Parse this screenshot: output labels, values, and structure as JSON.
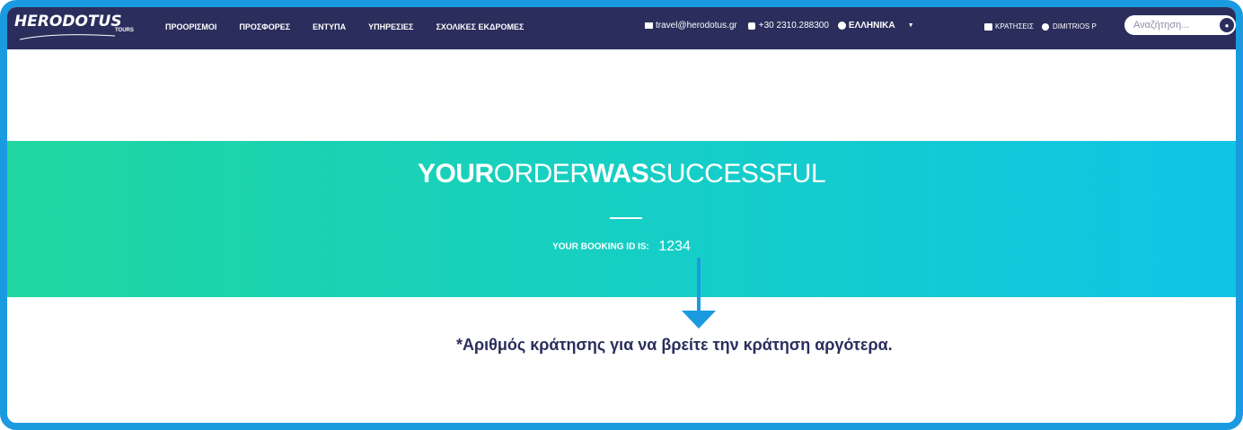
{
  "brand": {
    "logo_text": "HERODOTUS",
    "logo_sub": "TOURS"
  },
  "nav": {
    "items": [
      {
        "label": "ΠΡΟΟΡΙΣΜΟΙ"
      },
      {
        "label": "ΠΡΟΣΦΟΡΕΣ"
      },
      {
        "label": "ΕΝΤΥΠΑ"
      },
      {
        "label": "ΥΠΗΡΕΣΙΕΣ"
      },
      {
        "label": "ΣΧΟΛΙΚΕΣ ΕΚΔΡΟΜΕΣ"
      }
    ]
  },
  "contact": {
    "email": "travel@herodotus.gr",
    "phone": "+30 2310.288300",
    "language": "ΕΛΛΗΝΙΚΑ"
  },
  "account": {
    "bookings_label": "ΚΡΑΤΗΣΕΙΣ",
    "username": "DIMITRIOS P"
  },
  "search": {
    "placeholder": "Αναζήτηση..."
  },
  "banner": {
    "title_parts": [
      "YOUR",
      "ORDER",
      "WAS",
      "SUCCESSFUL"
    ],
    "booking_label": "YOUR BOOKING ID IS:",
    "booking_id": "1234"
  },
  "annotation": {
    "note": "*Αριθμός κράτησης για να βρείτε την κράτηση αργότερα.",
    "arrow_color": "#1a9be0"
  },
  "colors": {
    "nav_bg": "#2b2e5c",
    "banner_start": "#1fd6a0",
    "banner_end": "#0fc4e6",
    "frame": "#1a9be0"
  }
}
